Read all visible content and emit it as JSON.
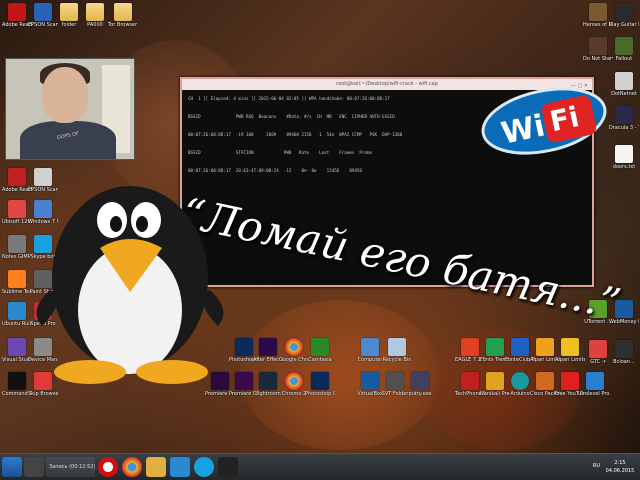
{
  "colors": {
    "terminal_border": "#d9a3a0",
    "wifi_blue": "#0a6bb8",
    "wifi_red": "#e02424",
    "taskbar": "#2b2f33"
  },
  "webcam": {
    "shirt_text": "OOPS OF"
  },
  "terminal": {
    "title": "root@kali:~/Desktop/wifi-crack - wifi.cap",
    "lines": [
      "CH  1 ][ Elapsed: 4 mins ][ 2015-06-04 02:05 ][ WPA handshake: 00:07:26:60:8D:17",
      "",
      "BSSID              PWR RXQ  Beacons    #Data, #/s  CH  MB   ENC  CIPHER AUTH ESSID",
      "",
      "00:07:26:60:8D:17  -19 100     2609    89468 2156   1  54e  WPA2 CCMP   PSK  DAP-1360",
      "",
      "BSSID              STATION            PWR   Rate    Lost    Frames  Probe",
      "",
      "00:07:26:60:8D:17  20:E3:47:09:0B:24  -12    0e- 0e    13456    89458"
    ]
  },
  "slogan": "“Ломай его батя...”",
  "wifi_logo": {
    "wi": "Wi",
    "fi": "Fi"
  },
  "left_icons": [
    {
      "label": "Adobe Reader XI"
    },
    {
      "label": "EPSON Scan"
    },
    {
      "label": "folder"
    },
    {
      "label": "PA000"
    },
    {
      "label": "Tor Browser - Новая папка"
    },
    {
      "label": "Ubisoft 120%"
    },
    {
      "label": "Windows 7 USB DVD..."
    },
    {
      "label": "Notes GIMP 2"
    },
    {
      "label": "Skype bot"
    },
    {
      "label": "Sublime Text"
    },
    {
      "label": "Paint Shop"
    },
    {
      "label": "Ubuntu Rule"
    },
    {
      "label": "Speed Pro"
    },
    {
      "label": "Visual Studio 2010"
    },
    {
      "label": "Device Manager"
    },
    {
      "label": "Command Prompt"
    },
    {
      "label": "Skip Browser"
    }
  ],
  "right_icons": [
    {
      "label": "Heroes of Newerth"
    },
    {
      "label": "Play Guitar Hero Mini"
    },
    {
      "label": "Fallout"
    },
    {
      "label": "DotNetnet"
    },
    {
      "label": "Do Not Starve Rei..."
    },
    {
      "label": "Dracula 3 - The Path..."
    },
    {
      "label": "doors.txt"
    },
    {
      "label": "UTorrent ..."
    },
    {
      "label": "WebMoney Keeper"
    },
    {
      "label": "GTC -r"
    },
    {
      "label": "Bcloan..."
    }
  ],
  "bottom_icons": [
    {
      "label": "Photoshop CS6"
    },
    {
      "label": "After Effects"
    },
    {
      "label": "Google Chrome"
    },
    {
      "label": "Camtasia"
    },
    {
      "label": "Computer"
    },
    {
      "label": "Recycle Bin"
    },
    {
      "label": "Premiere Pro"
    },
    {
      "label": "Premiere CS6"
    },
    {
      "label": "Lightroom"
    },
    {
      "label": "Chrome 2"
    },
    {
      "label": "Photoshop CS5"
    },
    {
      "label": "VirtualBox"
    },
    {
      "label": "SVT Folder"
    },
    {
      "label": "putty.exe"
    },
    {
      "label": "EAGLE 7.1.0"
    },
    {
      "label": "Fonts Trend MT4"
    },
    {
      "label": "FonteClub MT4"
    },
    {
      "label": "Alpari Limited MT4"
    },
    {
      "label": "Alpari Limited MT5"
    },
    {
      "label": "TechPhone SPB-Z"
    },
    {
      "label": "Nanikali Premiere"
    },
    {
      "label": "Arduino"
    },
    {
      "label": "Cisco Packet Tracer"
    },
    {
      "label": "Free YouTube..."
    },
    {
      "label": "Prolevel Pro..."
    }
  ],
  "taskbar": {
    "task_label": "Запись (00:12:52)",
    "clock_time": "2:15",
    "clock_date": "04.06.2015",
    "tray_text": "RU"
  }
}
